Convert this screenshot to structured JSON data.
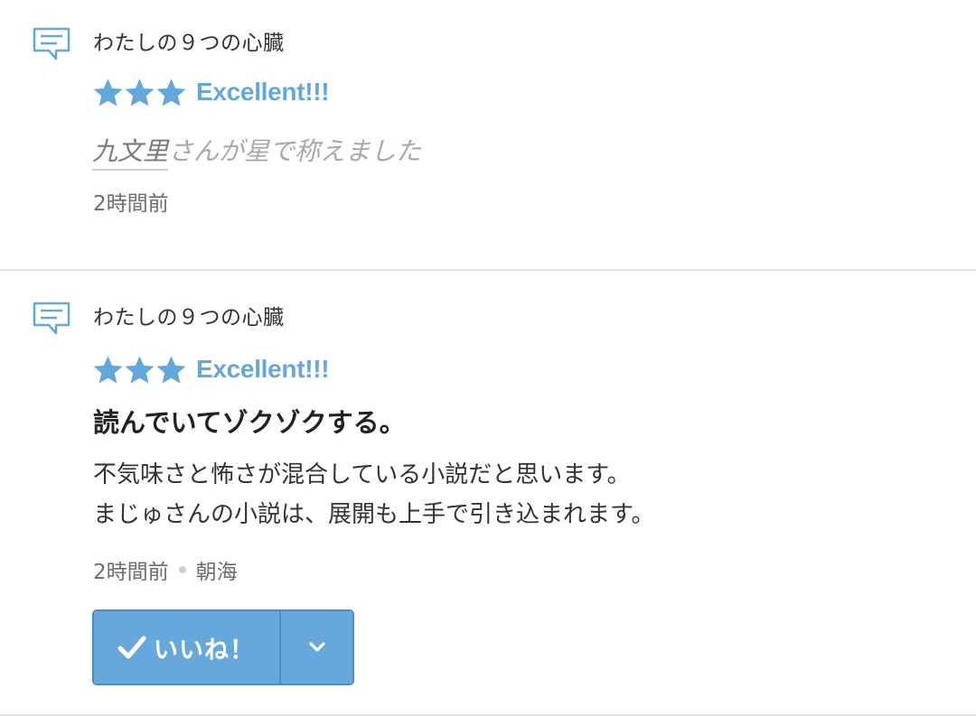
{
  "colors": {
    "accent": "#64a8db",
    "button": "#66a8dc",
    "divider": "#e3e3e3",
    "muted_text": "#6e6e6e"
  },
  "feed": [
    {
      "type": "star-praise",
      "icon": "comment-icon",
      "novel_title": "わたしの９つの心臓",
      "stars": 3,
      "rating_label": "Excellent!!!",
      "praise_user": "九文里",
      "praise_suffix": "さんが星で称えました",
      "time": "2時間前"
    },
    {
      "type": "review",
      "icon": "comment-icon",
      "novel_title": "わたしの９つの心臓",
      "stars": 3,
      "rating_label": "Excellent!!!",
      "review_title": "読んでいてゾクゾクする。",
      "review_body_lines": [
        "不気味さと怖さが混合している小説だと思います。",
        "まじゅさんの小説は、展開も上手で引き込まれます。"
      ],
      "time": "2時間前",
      "author": "朝海",
      "like_label": "いいね！"
    }
  ]
}
